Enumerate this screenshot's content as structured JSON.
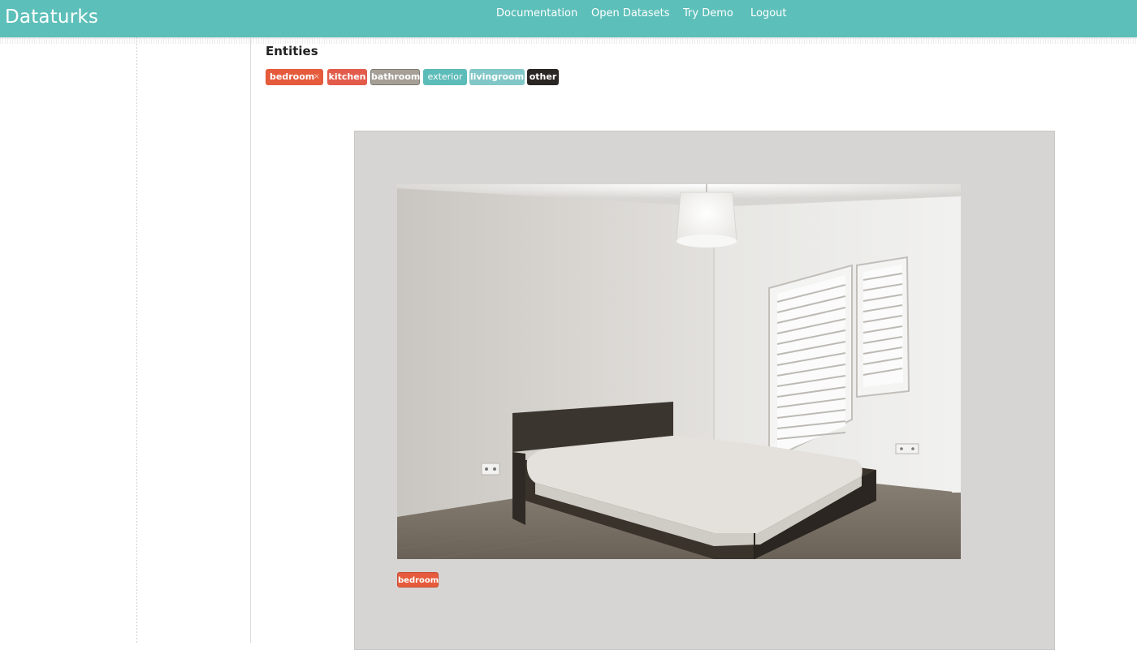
{
  "app": {
    "brand": "Dataturks",
    "nav": [
      "Documentation",
      "Open Datasets",
      "Try Demo",
      "Logout"
    ],
    "accent": "#5dbfb9"
  },
  "entities": {
    "title": "Entities",
    "labels": [
      {
        "name": "bedroom",
        "color": "#e55b3c",
        "selected": true,
        "remove_icon": "×"
      },
      {
        "name": "kitchen",
        "color": "#e25b4b",
        "selected": false
      },
      {
        "name": "bathroom",
        "color": "#a59f96",
        "selected": false
      },
      {
        "name": "exterior",
        "color": "#5cbcb8",
        "selected": false
      },
      {
        "name": "livingroom",
        "color": "#82c7c7",
        "selected": false
      },
      {
        "name": "other",
        "color": "#2a2623",
        "selected": false
      }
    ]
  },
  "image": {
    "subject": "bedroom photo",
    "assigned_label": "bedroom",
    "assigned_label_color": "#e55b3c"
  },
  "icons": [
    "remove-label-icon"
  ]
}
